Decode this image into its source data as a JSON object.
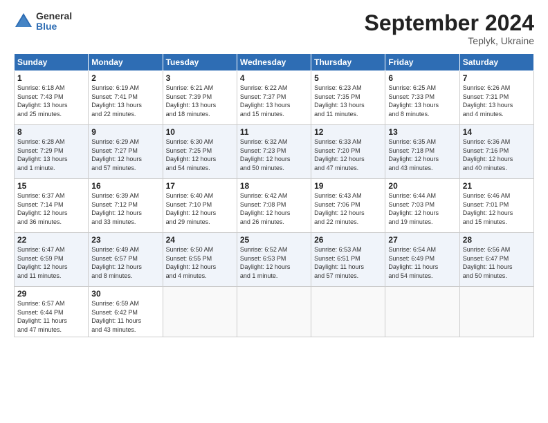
{
  "header": {
    "logo_general": "General",
    "logo_blue": "Blue",
    "month_title": "September 2024",
    "subtitle": "Teplyk, Ukraine"
  },
  "weekdays": [
    "Sunday",
    "Monday",
    "Tuesday",
    "Wednesday",
    "Thursday",
    "Friday",
    "Saturday"
  ],
  "days": [
    {
      "row": 1,
      "cells": [
        {
          "num": "1",
          "info": "Sunrise: 6:18 AM\nSunset: 7:43 PM\nDaylight: 13 hours\nand 25 minutes."
        },
        {
          "num": "2",
          "info": "Sunrise: 6:19 AM\nSunset: 7:41 PM\nDaylight: 13 hours\nand 22 minutes."
        },
        {
          "num": "3",
          "info": "Sunrise: 6:21 AM\nSunset: 7:39 PM\nDaylight: 13 hours\nand 18 minutes."
        },
        {
          "num": "4",
          "info": "Sunrise: 6:22 AM\nSunset: 7:37 PM\nDaylight: 13 hours\nand 15 minutes."
        },
        {
          "num": "5",
          "info": "Sunrise: 6:23 AM\nSunset: 7:35 PM\nDaylight: 13 hours\nand 11 minutes."
        },
        {
          "num": "6",
          "info": "Sunrise: 6:25 AM\nSunset: 7:33 PM\nDaylight: 13 hours\nand 8 minutes."
        },
        {
          "num": "7",
          "info": "Sunrise: 6:26 AM\nSunset: 7:31 PM\nDaylight: 13 hours\nand 4 minutes."
        }
      ]
    },
    {
      "row": 2,
      "cells": [
        {
          "num": "8",
          "info": "Sunrise: 6:28 AM\nSunset: 7:29 PM\nDaylight: 13 hours\nand 1 minute."
        },
        {
          "num": "9",
          "info": "Sunrise: 6:29 AM\nSunset: 7:27 PM\nDaylight: 12 hours\nand 57 minutes."
        },
        {
          "num": "10",
          "info": "Sunrise: 6:30 AM\nSunset: 7:25 PM\nDaylight: 12 hours\nand 54 minutes."
        },
        {
          "num": "11",
          "info": "Sunrise: 6:32 AM\nSunset: 7:23 PM\nDaylight: 12 hours\nand 50 minutes."
        },
        {
          "num": "12",
          "info": "Sunrise: 6:33 AM\nSunset: 7:20 PM\nDaylight: 12 hours\nand 47 minutes."
        },
        {
          "num": "13",
          "info": "Sunrise: 6:35 AM\nSunset: 7:18 PM\nDaylight: 12 hours\nand 43 minutes."
        },
        {
          "num": "14",
          "info": "Sunrise: 6:36 AM\nSunset: 7:16 PM\nDaylight: 12 hours\nand 40 minutes."
        }
      ]
    },
    {
      "row": 3,
      "cells": [
        {
          "num": "15",
          "info": "Sunrise: 6:37 AM\nSunset: 7:14 PM\nDaylight: 12 hours\nand 36 minutes."
        },
        {
          "num": "16",
          "info": "Sunrise: 6:39 AM\nSunset: 7:12 PM\nDaylight: 12 hours\nand 33 minutes."
        },
        {
          "num": "17",
          "info": "Sunrise: 6:40 AM\nSunset: 7:10 PM\nDaylight: 12 hours\nand 29 minutes."
        },
        {
          "num": "18",
          "info": "Sunrise: 6:42 AM\nSunset: 7:08 PM\nDaylight: 12 hours\nand 26 minutes."
        },
        {
          "num": "19",
          "info": "Sunrise: 6:43 AM\nSunset: 7:06 PM\nDaylight: 12 hours\nand 22 minutes."
        },
        {
          "num": "20",
          "info": "Sunrise: 6:44 AM\nSunset: 7:03 PM\nDaylight: 12 hours\nand 19 minutes."
        },
        {
          "num": "21",
          "info": "Sunrise: 6:46 AM\nSunset: 7:01 PM\nDaylight: 12 hours\nand 15 minutes."
        }
      ]
    },
    {
      "row": 4,
      "cells": [
        {
          "num": "22",
          "info": "Sunrise: 6:47 AM\nSunset: 6:59 PM\nDaylight: 12 hours\nand 11 minutes."
        },
        {
          "num": "23",
          "info": "Sunrise: 6:49 AM\nSunset: 6:57 PM\nDaylight: 12 hours\nand 8 minutes."
        },
        {
          "num": "24",
          "info": "Sunrise: 6:50 AM\nSunset: 6:55 PM\nDaylight: 12 hours\nand 4 minutes."
        },
        {
          "num": "25",
          "info": "Sunrise: 6:52 AM\nSunset: 6:53 PM\nDaylight: 12 hours\nand 1 minute."
        },
        {
          "num": "26",
          "info": "Sunrise: 6:53 AM\nSunset: 6:51 PM\nDaylight: 11 hours\nand 57 minutes."
        },
        {
          "num": "27",
          "info": "Sunrise: 6:54 AM\nSunset: 6:49 PM\nDaylight: 11 hours\nand 54 minutes."
        },
        {
          "num": "28",
          "info": "Sunrise: 6:56 AM\nSunset: 6:47 PM\nDaylight: 11 hours\nand 50 minutes."
        }
      ]
    },
    {
      "row": 5,
      "cells": [
        {
          "num": "29",
          "info": "Sunrise: 6:57 AM\nSunset: 6:44 PM\nDaylight: 11 hours\nand 47 minutes."
        },
        {
          "num": "30",
          "info": "Sunrise: 6:59 AM\nSunset: 6:42 PM\nDaylight: 11 hours\nand 43 minutes."
        },
        {
          "num": "",
          "info": ""
        },
        {
          "num": "",
          "info": ""
        },
        {
          "num": "",
          "info": ""
        },
        {
          "num": "",
          "info": ""
        },
        {
          "num": "",
          "info": ""
        }
      ]
    }
  ]
}
